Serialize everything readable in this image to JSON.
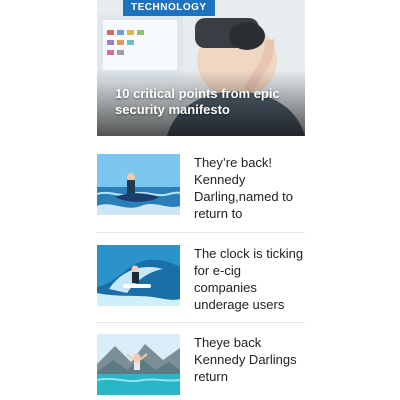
{
  "featured": {
    "category": "TECHNOLOGY",
    "title": "10 critical points from epic security manifesto"
  },
  "items": [
    {
      "title": "They’re back! Kennedy Darling,named to return to"
    },
    {
      "title": "The clock is ticking for e-cig companies underage users"
    },
    {
      "title": "Theye back Kennedy Darlings return"
    }
  ]
}
